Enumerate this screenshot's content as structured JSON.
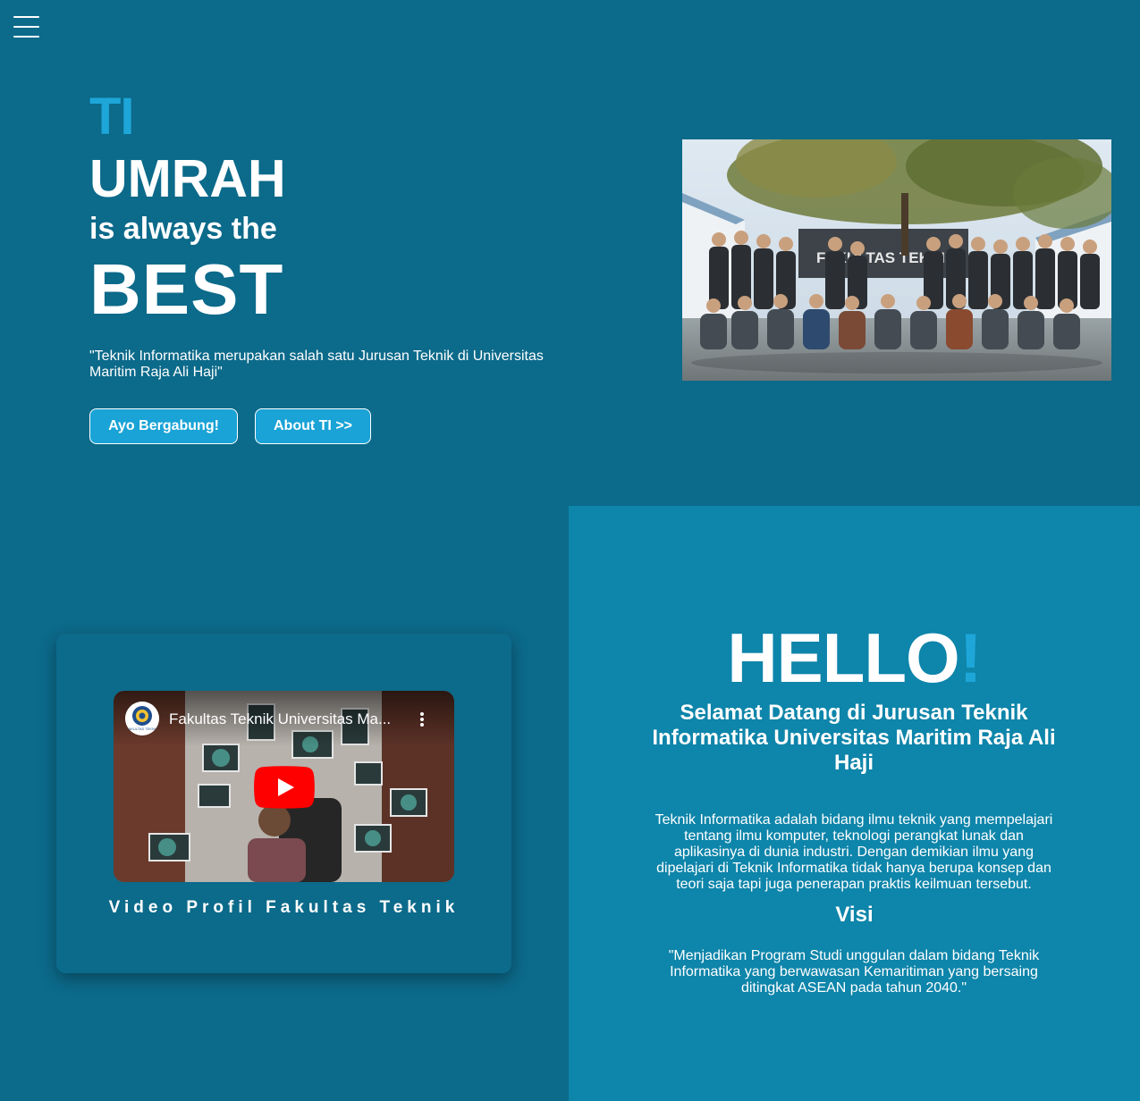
{
  "nav": {
    "menu_icon": "hamburger-menu-icon"
  },
  "hero": {
    "ti": "TI",
    "umrah": "UMRAH",
    "always": "is always the",
    "best": "BEST",
    "quote": "\"Teknik Informatika merupakan salah satu Jurusan Teknik di Universitas Maritim Raja Ali Haji\"",
    "join_button": "Ayo Bergabung!",
    "about_button": "About TI >>",
    "photo_sign": "FAKULTAS TEKNIK"
  },
  "video": {
    "title": "Fakultas Teknik Universitas Ma...",
    "channel_logo_text": "FAKULTAS TEKNIK",
    "caption": "Video Profil Fakultas Teknik"
  },
  "hello": {
    "title": "HELLO",
    "exclaim": "!",
    "welcome": "Selamat Datang di Jurusan Teknik Informatika Universitas Maritim Raja Ali Haji",
    "intro": "Teknik Informatika adalah bidang ilmu teknik yang mempelajari tentang ilmu komputer, teknologi perangkat lunak dan aplikasinya di dunia industri. Dengan demikian ilmu yang dipelajari di Teknik Informatika tidak hanya berupa konsep dan teori saja tapi juga penerapan praktis keilmuan tersebut.",
    "visi_title": "Visi",
    "visi_text": "\"Menjadikan Program Studi unggulan dalam bidang Teknik Informatika yang berwawasan Kemaritiman yang bersaing ditingkat ASEAN pada tahun 2040.\""
  },
  "colors": {
    "page_background": "#0c6a8a",
    "panel_background": "#0e85aa",
    "accent": "#1ea6d8",
    "button": "#19a3d6",
    "youtube_red": "#ff0000"
  }
}
